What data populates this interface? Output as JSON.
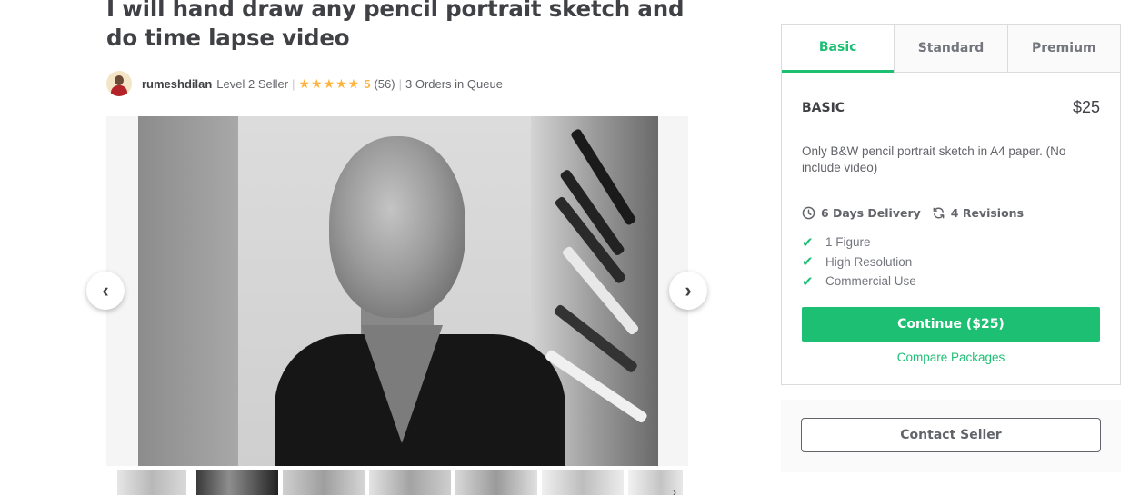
{
  "gig": {
    "title": "I will hand draw any pencil portrait sketch and do time lapse video"
  },
  "seller": {
    "name": "rumeshdilan",
    "level": "Level 2 Seller",
    "separator": "|",
    "stars": "★★★★★",
    "rating": "5",
    "reviews": "(56)",
    "queue": "3 Orders in Queue"
  },
  "gallery": {
    "prev_icon": "‹",
    "next_icon": "›",
    "thumb_more_icon": "›",
    "thumbnail_count": 7,
    "active_thumbnail": 2
  },
  "package": {
    "tabs": [
      "Basic",
      "Standard",
      "Premium"
    ],
    "active_tab": "Basic",
    "name": "BASIC",
    "price": "$25",
    "description": "Only B&W pencil portrait sketch in A4 paper. (No include video)",
    "delivery": "6 Days Delivery",
    "revisions": "4 Revisions",
    "features": [
      "1 Figure",
      "High Resolution",
      "Commercial Use"
    ],
    "continue_label": "Continue ($25)",
    "compare_label": "Compare Packages"
  },
  "contact": {
    "label": "Contact Seller"
  },
  "colors": {
    "accent": "#1dbf73",
    "star": "#ffb33e",
    "text": "#404145"
  },
  "icons": {
    "check": "✔",
    "clock": "clock-icon",
    "revisions": "refresh-icon"
  }
}
